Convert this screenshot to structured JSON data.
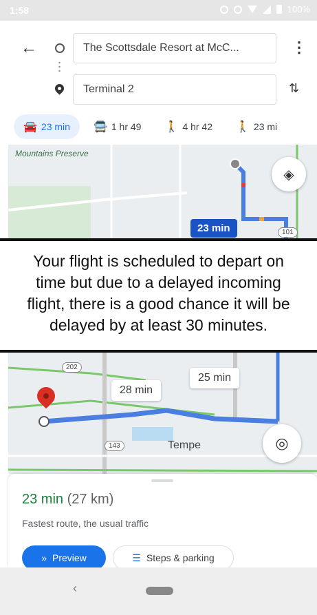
{
  "status_bar": {
    "time": "1:58",
    "battery": "100%"
  },
  "directions": {
    "origin": "The Scottsdale Resort at McC...",
    "destination": "Terminal 2"
  },
  "travel_modes": [
    {
      "icon": "car-icon",
      "label": "23 min",
      "active": true
    },
    {
      "icon": "transit-icon",
      "label": "1 hr 49",
      "active": false
    },
    {
      "icon": "walk-icon",
      "label": "4 hr 42",
      "active": false
    },
    {
      "icon": "ride-icon",
      "label": "23 mi",
      "active": false
    }
  ],
  "map_top": {
    "area_label": "Mountains Preserve",
    "eta_label": "23 min",
    "shield": "101"
  },
  "message": "Your flight is scheduled to depart on time but due to a delayed incoming flight, there is a good chance it will be delayed by at least 30 minutes.",
  "map_bottom": {
    "route_bubble_1": "28 min",
    "route_bubble_2": "25 min",
    "shield_1": "202",
    "shield_2": "143",
    "city_label": "Tempe"
  },
  "route_sheet": {
    "duration": "23 min",
    "distance": "(27 km)",
    "description": "Fastest route, the usual traffic",
    "preview_label": "Preview",
    "steps_label": "Steps & parking"
  },
  "colors": {
    "accent": "#1a73e8",
    "route": "#4a7ee0",
    "duration_green": "#188038"
  }
}
